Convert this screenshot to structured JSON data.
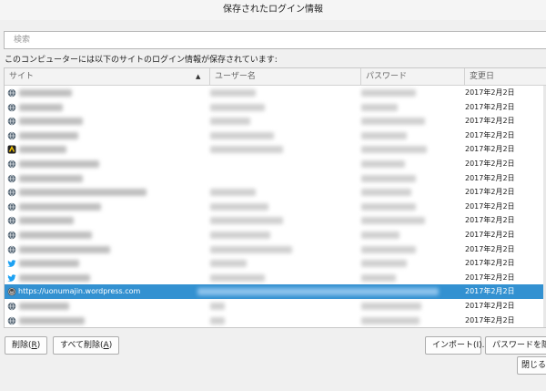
{
  "window": {
    "title": "保存されたログイン情報"
  },
  "search": {
    "placeholder": "検索",
    "value": ""
  },
  "description": "このコンピューターには以下のサイトのログイン情報が保存されています:",
  "table": {
    "columns": {
      "site": "サイト",
      "username": "ユーザー名",
      "password": "パスワード",
      "changed": "変更日"
    },
    "sort_column": "site",
    "sort_direction": "ascending",
    "rows": [
      {
        "icon": "globe-icon",
        "site": "",
        "date": "2017年2月2日"
      },
      {
        "icon": "globe-icon",
        "site": "",
        "date": "2017年2月2日"
      },
      {
        "icon": "globe-icon",
        "site": "",
        "date": "2017年2月2日"
      },
      {
        "icon": "globe-icon",
        "site": "",
        "date": "2017年2月2日"
      },
      {
        "icon": "brand-icon",
        "site": "",
        "date": "2017年2月2日"
      },
      {
        "icon": "globe-icon",
        "site": "",
        "date": "2017年2月2日"
      },
      {
        "icon": "globe-icon",
        "site": "",
        "date": "2017年2月2日"
      },
      {
        "icon": "globe-icon",
        "site": "",
        "date": "2017年2月2日"
      },
      {
        "icon": "globe-icon",
        "site": "",
        "date": "2017年2月2日"
      },
      {
        "icon": "globe-icon",
        "site": "",
        "date": "2017年2月2日"
      },
      {
        "icon": "globe-icon",
        "site": "",
        "date": "2017年2月2日"
      },
      {
        "icon": "globe-icon",
        "site": "",
        "date": "2017年2月2日"
      },
      {
        "icon": "twitter-icon",
        "site": "",
        "date": "2017年2月2日"
      },
      {
        "icon": "twitter-icon",
        "site": "",
        "date": "2017年2月2日"
      },
      {
        "icon": "wordpress-icon",
        "site": "https://uonumajin.wordpress.com",
        "date": "2017年2月2日",
        "selected": true
      },
      {
        "icon": "globe-icon",
        "site": "",
        "date": "2017年2月2日"
      },
      {
        "icon": "globe-icon",
        "site": "",
        "date": "2017年2月2日"
      }
    ]
  },
  "buttons": {
    "remove": {
      "label": "削除",
      "mnemonic": "R"
    },
    "remove_all": {
      "label": "すべて削除",
      "mnemonic": "A"
    },
    "import": {
      "label": "インポート(I)..."
    },
    "show_passwords": {
      "label": "パスワードを隠す"
    },
    "close": {
      "label": "閉じる(C)"
    }
  },
  "colors": {
    "selection": "#3391d1",
    "background": "#f0f0f0",
    "twitter": "#1da1f2"
  }
}
